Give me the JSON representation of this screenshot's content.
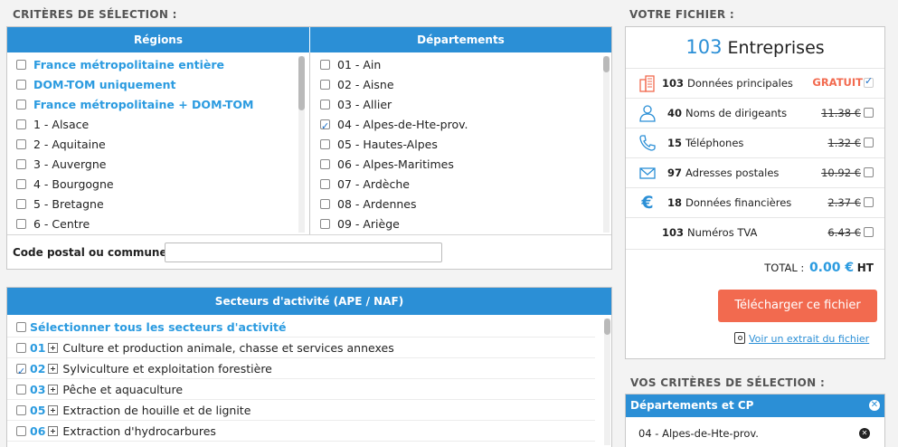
{
  "left_title": "CRITÈRES DE SÉLECTION :",
  "regions": {
    "header": "Régions",
    "items": [
      {
        "label": "France métropolitaine entière",
        "special": true,
        "checked": false
      },
      {
        "label": "DOM-TOM uniquement",
        "special": true,
        "checked": false
      },
      {
        "label": "France métropolitaine + DOM-TOM",
        "special": true,
        "checked": false
      },
      {
        "label": "1 - Alsace",
        "special": false,
        "checked": false
      },
      {
        "label": "2 - Aquitaine",
        "special": false,
        "checked": false
      },
      {
        "label": "3 - Auvergne",
        "special": false,
        "checked": false
      },
      {
        "label": "4 - Bourgogne",
        "special": false,
        "checked": false
      },
      {
        "label": "5 - Bretagne",
        "special": false,
        "checked": false
      },
      {
        "label": "6 - Centre",
        "special": false,
        "checked": false
      }
    ]
  },
  "departements": {
    "header": "Départements",
    "items": [
      {
        "label": "01 - Ain",
        "checked": false
      },
      {
        "label": "02 - Aisne",
        "checked": false
      },
      {
        "label": "03 - Allier",
        "checked": false
      },
      {
        "label": "04 - Alpes-de-Hte-prov.",
        "checked": true
      },
      {
        "label": "05 - Hautes-Alpes",
        "checked": false
      },
      {
        "label": "06 - Alpes-Maritimes",
        "checked": false
      },
      {
        "label": "07 - Ardèche",
        "checked": false
      },
      {
        "label": "08 - Ardennes",
        "checked": false
      },
      {
        "label": "09 - Ariège",
        "checked": false
      }
    ]
  },
  "postal": {
    "label": "Code postal ou commune :",
    "value": ""
  },
  "sectors": {
    "header": "Secteurs d'activité (APE / NAF)",
    "select_all": "Sélectionner tous les secteurs d'activité",
    "items": [
      {
        "code": "01",
        "label": "Culture et production animale, chasse et services annexes",
        "checked": false
      },
      {
        "code": "02",
        "label": "Sylviculture et exploitation forestière",
        "checked": true
      },
      {
        "code": "03",
        "label": "Pêche et aquaculture",
        "checked": false
      },
      {
        "code": "05",
        "label": "Extraction de houille et de lignite",
        "checked": false
      },
      {
        "code": "06",
        "label": "Extraction d'hydrocarbures",
        "checked": false
      }
    ]
  },
  "fichier": {
    "title": "VOTRE FICHIER :",
    "count": "103",
    "count_label": "Entreprises",
    "rows": [
      {
        "icon": "building-icon",
        "num": "103",
        "label": "Données principales",
        "price": "GRATUIT",
        "free": true
      },
      {
        "icon": "person-icon",
        "num": "40",
        "label": "Noms de dirigeants",
        "price": "11.38 €",
        "free": false
      },
      {
        "icon": "phone-icon",
        "num": "15",
        "label": "Téléphones",
        "price": "1.32 €",
        "free": false
      },
      {
        "icon": "envelope-icon",
        "num": "97",
        "label": "Adresses postales",
        "price": "10.92 €",
        "free": false
      },
      {
        "icon": "euro-icon",
        "num": "18",
        "label": "Données financières",
        "price": "2.37 €",
        "free": false
      },
      {
        "icon": "",
        "num": "103",
        "label": "Numéros TVA",
        "price": "6.43 €",
        "free": false
      }
    ],
    "total_label": "TOTAL :",
    "total_value": "0.00 €",
    "total_suffix": "HT",
    "download": "Télécharger ce fichier",
    "extract_link": "Voir un extrait du fichier",
    "accent": "#f26a4f",
    "brand": "#2b8fd6"
  },
  "criteria": {
    "title": "VOS CRITÈRES DE SÉLECTION :",
    "group_header": "Départements et CP",
    "items": [
      "04 - Alpes-de-Hte-prov."
    ]
  }
}
